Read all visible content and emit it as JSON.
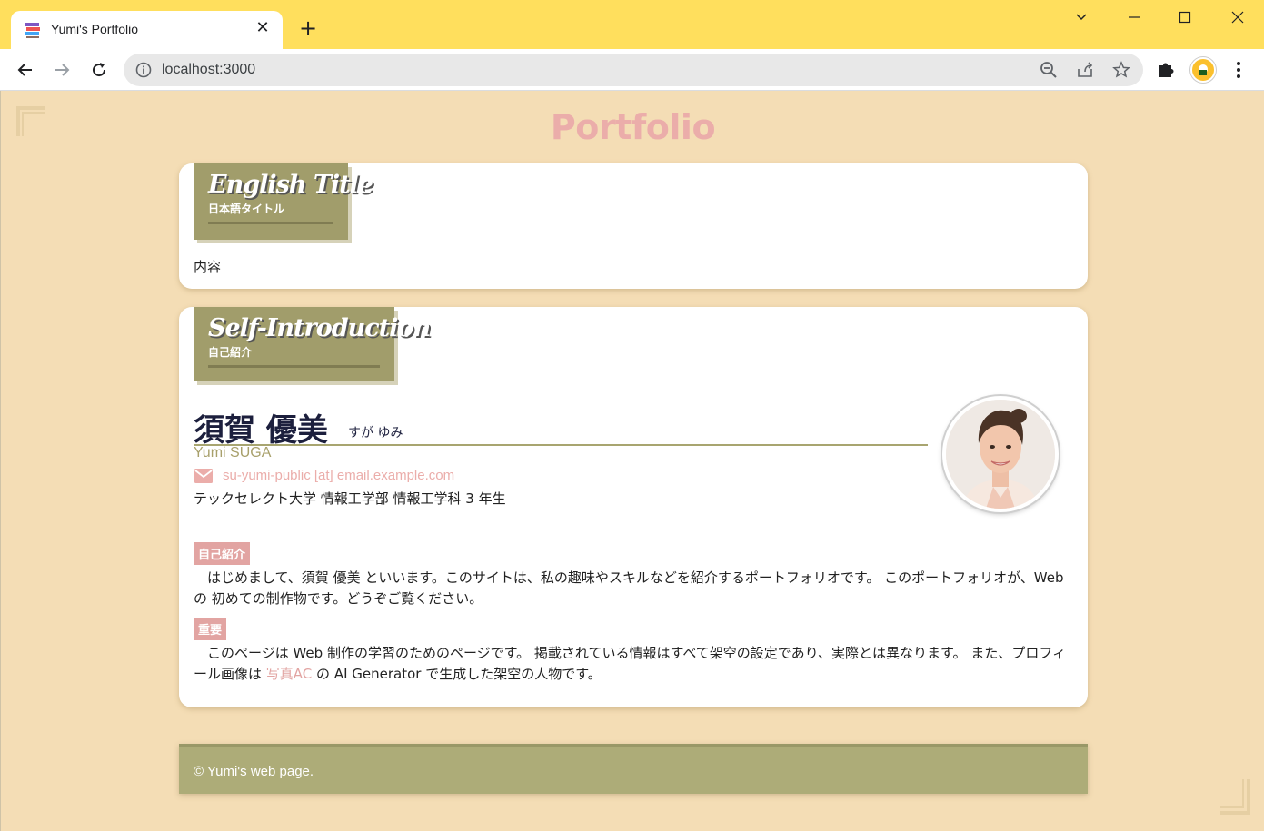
{
  "browser": {
    "tab_title": "Yumi's Portfolio",
    "url": "localhost:3000"
  },
  "page": {
    "title": "Portfolio",
    "sections": [
      {
        "title_en": "English Title",
        "title_jp": "日本語タイトル",
        "content": "内容"
      },
      {
        "title_en": "Self-Introduction",
        "title_jp": "自己紹介"
      }
    ],
    "profile": {
      "name_kanji": "須賀 優美",
      "name_kana": "すが ゆみ",
      "name_en": "Yumi SUGA",
      "email": "su-yumi-public [at] email.example.com",
      "school": "テックセレクト大学 情報工学部 情報工学科 3 年生"
    },
    "intro": {
      "label": "自己紹介",
      "text": "はじめまして、須賀 優美 といいます。このサイトは、私の趣味やスキルなどを紹介するポートフォリオです。 このポートフォリオが、Web の 初めての制作物です。どうぞご覧ください。"
    },
    "important": {
      "label": "重要",
      "text_before": "このページは Web 制作の学習のためのページです。 掲載されている情報はすべて架空の設定であり、実際とは異なります。 また、プロフィール画像は ",
      "link": "写真AC",
      "text_after": " の AI Generator で生成した架空の人物です。"
    },
    "footer": "© Yumi's web page."
  },
  "colors": {
    "background": "#f4ddb5",
    "accent_pink": "#ebadaa",
    "olive": "#a19d6b",
    "footer": "#adac78",
    "titlebar": "#ffdf5d"
  }
}
